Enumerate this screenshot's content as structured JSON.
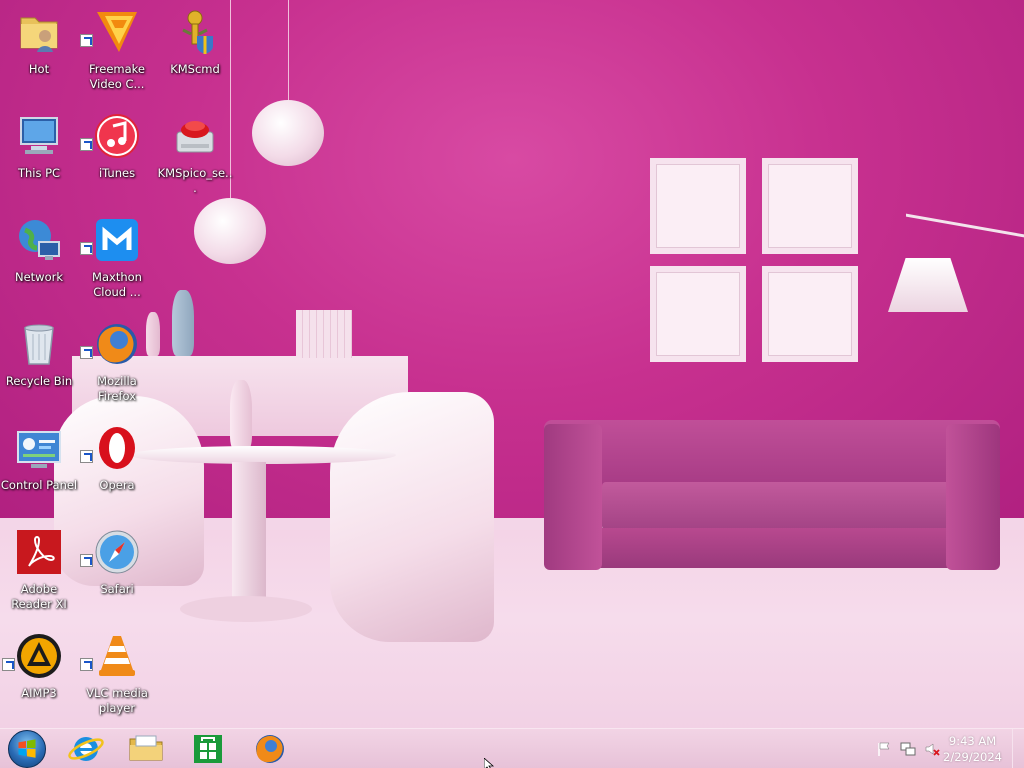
{
  "desktop": {
    "icons": [
      {
        "label": "Hot",
        "icon": "user-folder-icon",
        "shortcut": false
      },
      {
        "label": "Freemake Video C...",
        "icon": "freemake-video-icon",
        "shortcut": true
      },
      {
        "label": "KMScmd",
        "icon": "kmscmd-icon",
        "shortcut": false
      },
      {
        "label": "This PC",
        "icon": "computer-icon",
        "shortcut": false
      },
      {
        "label": "iTunes",
        "icon": "itunes-icon",
        "shortcut": true
      },
      {
        "label": "KMSpico_se...",
        "icon": "kmspico-icon",
        "shortcut": false
      },
      {
        "label": "Network",
        "icon": "network-icon",
        "shortcut": false
      },
      {
        "label": "Maxthon Cloud ...",
        "icon": "maxthon-icon",
        "shortcut": true
      },
      {
        "label": "Recycle Bin",
        "icon": "recycle-bin-icon",
        "shortcut": false
      },
      {
        "label": "Mozilla Firefox",
        "icon": "firefox-icon",
        "shortcut": true
      },
      {
        "label": "Control Panel",
        "icon": "control-panel-icon",
        "shortcut": false
      },
      {
        "label": "Opera",
        "icon": "opera-icon",
        "shortcut": true
      },
      {
        "label": "Adobe Reader XI",
        "icon": "adobe-reader-icon",
        "shortcut": false
      },
      {
        "label": "Safari",
        "icon": "safari-icon",
        "shortcut": true
      },
      {
        "label": "AIMP3",
        "icon": "aimp-icon",
        "shortcut": true
      },
      {
        "label": "VLC media player",
        "icon": "vlc-icon",
        "shortcut": true
      }
    ]
  },
  "taskbar": {
    "pinned": [
      {
        "name": "start-button",
        "icon": "windows-orb-icon"
      },
      {
        "name": "internet-explorer",
        "icon": "internet-explorer-icon"
      },
      {
        "name": "file-explorer",
        "icon": "file-explorer-icon"
      },
      {
        "name": "windows-store",
        "icon": "store-icon"
      },
      {
        "name": "firefox",
        "icon": "firefox-icon"
      }
    ],
    "tray": {
      "icons": [
        "action-center-flag-icon",
        "network-tray-icon",
        "volume-muted-icon"
      ],
      "time": "9:43 AM",
      "date": "2/29/2024"
    }
  },
  "colors": {
    "wall": "#c52c8f",
    "floor": "#f4d3e6",
    "taskbar": "#ecc8dc",
    "accent": "#1a56c8"
  }
}
